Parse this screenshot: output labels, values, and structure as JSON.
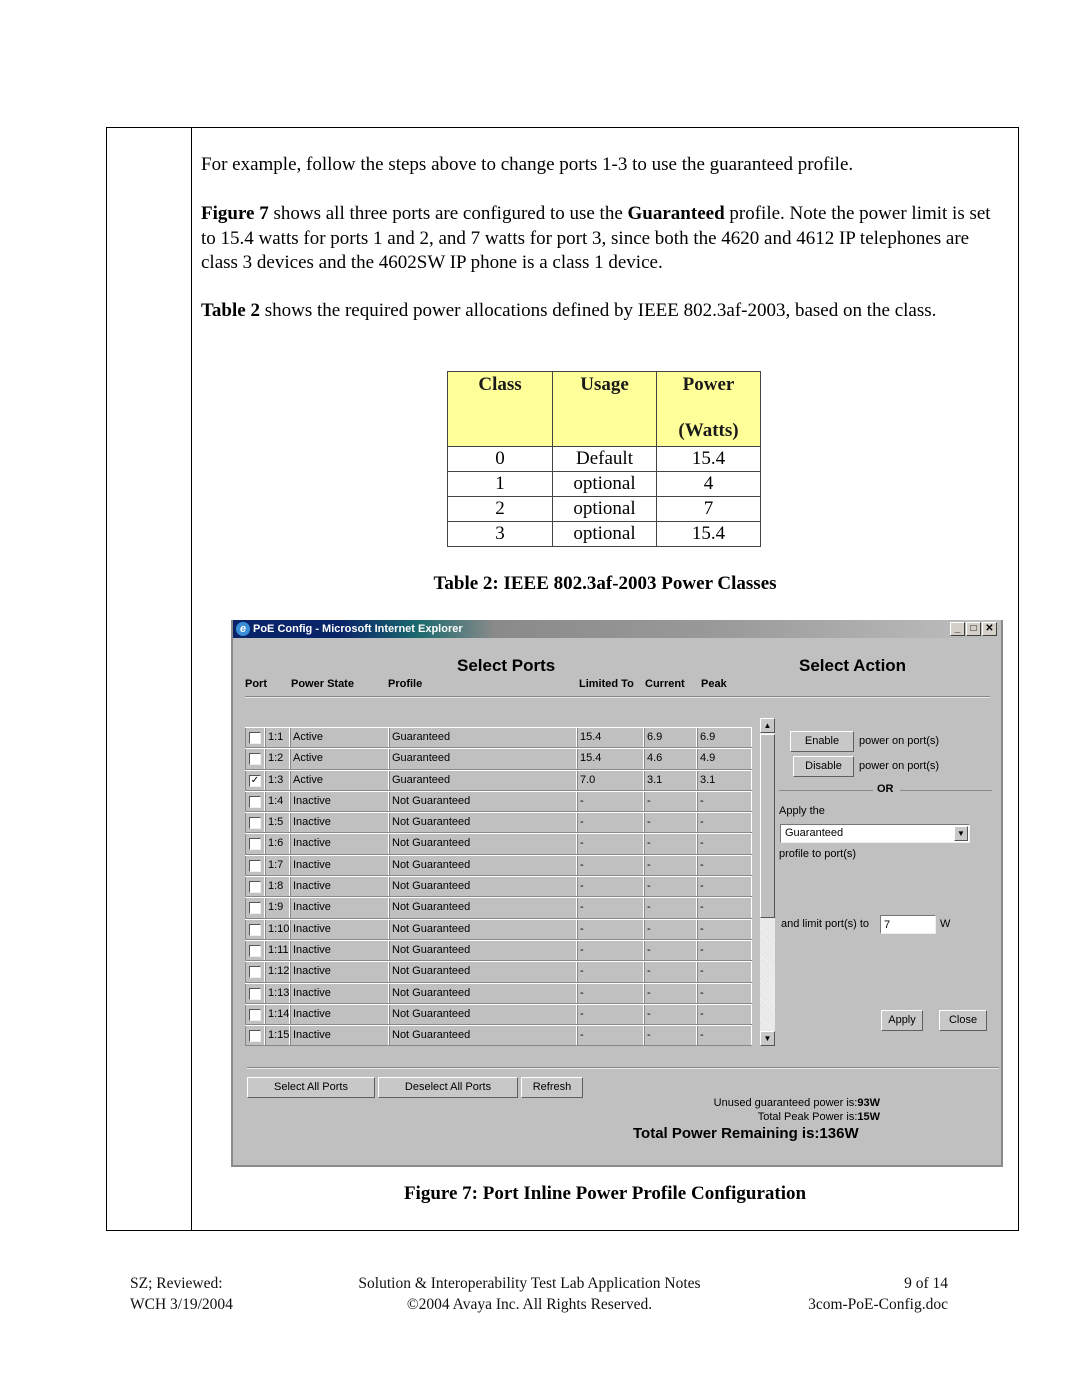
{
  "document": {
    "paragraphs": {
      "p1": "For example, follow the steps above to change ports 1-3 to use the guaranteed profile.",
      "p2_bold1": "Figure 7",
      "p2_text1": " shows all three ports are configured to use the ",
      "p2_bold2": "Guaranteed",
      "p2_text2": " profile. Note the power limit is set to 15.4 watts for ports 1 and 2, and 7 watts for port 3, since both the 4620 and 4612 IP telephones are class 3 devices and the 4602SW IP phone is a class 1 device.",
      "p3_bold": "Table 2",
      "p3_text": " shows the required power allocations defined by IEEE 802.3af-2003, based on the class."
    },
    "power_table": {
      "headers": [
        "Class",
        "Usage",
        "Power",
        "(Watts)"
      ],
      "rows": [
        [
          "0",
          "Default",
          "15.4"
        ],
        [
          "1",
          "optional",
          "4"
        ],
        [
          "2",
          "optional",
          "7"
        ],
        [
          "3",
          "optional",
          "15.4"
        ]
      ],
      "header_color": "#ffff99"
    },
    "table_caption": "Table 2: IEEE 802.3af-2003 Power Classes",
    "figure_caption": "Figure 7: Port Inline Power Profile Configuration",
    "footer": {
      "left_line1": "SZ; Reviewed:",
      "left_line2": "WCH 3/19/2004",
      "center_line1": "Solution & Interoperability Test Lab Application Notes",
      "center_line2": "©2004 Avaya Inc. All Rights Reserved.",
      "right_line1": "9 of 14",
      "right_line2": "3com-PoE-Config.doc"
    }
  },
  "window": {
    "title": "PoE Config - Microsoft Internet Explorer",
    "controls": {
      "minimize": "_",
      "maximize": "□",
      "close": "✕"
    },
    "select_ports_title": "Select Ports",
    "select_action_title": "Select Action",
    "columns": [
      "Port",
      "Power State",
      "Profile",
      "Limited To",
      "Current",
      "Peak"
    ],
    "ports": [
      {
        "checked": false,
        "port": "1:1",
        "state": "Active",
        "profile": "Guaranteed",
        "limit": "15.4",
        "current": "6.9",
        "peak": "6.9"
      },
      {
        "checked": false,
        "port": "1:2",
        "state": "Active",
        "profile": "Guaranteed",
        "limit": "15.4",
        "current": "4.6",
        "peak": "4.9"
      },
      {
        "checked": true,
        "port": "1:3",
        "state": "Active",
        "profile": "Guaranteed",
        "limit": "7.0",
        "current": "3.1",
        "peak": "3.1"
      },
      {
        "checked": false,
        "port": "1:4",
        "state": "Inactive",
        "profile": "Not Guaranteed",
        "limit": "-",
        "current": "-",
        "peak": "-"
      },
      {
        "checked": false,
        "port": "1:5",
        "state": "Inactive",
        "profile": "Not Guaranteed",
        "limit": "-",
        "current": "-",
        "peak": "-"
      },
      {
        "checked": false,
        "port": "1:6",
        "state": "Inactive",
        "profile": "Not Guaranteed",
        "limit": "-",
        "current": "-",
        "peak": "-"
      },
      {
        "checked": false,
        "port": "1:7",
        "state": "Inactive",
        "profile": "Not Guaranteed",
        "limit": "-",
        "current": "-",
        "peak": "-"
      },
      {
        "checked": false,
        "port": "1:8",
        "state": "Inactive",
        "profile": "Not Guaranteed",
        "limit": "-",
        "current": "-",
        "peak": "-"
      },
      {
        "checked": false,
        "port": "1:9",
        "state": "Inactive",
        "profile": "Not Guaranteed",
        "limit": "-",
        "current": "-",
        "peak": "-"
      },
      {
        "checked": false,
        "port": "1:10",
        "state": "Inactive",
        "profile": "Not Guaranteed",
        "limit": "-",
        "current": "-",
        "peak": "-"
      },
      {
        "checked": false,
        "port": "1:11",
        "state": "Inactive",
        "profile": "Not Guaranteed",
        "limit": "-",
        "current": "-",
        "peak": "-"
      },
      {
        "checked": false,
        "port": "1:12",
        "state": "Inactive",
        "profile": "Not Guaranteed",
        "limit": "-",
        "current": "-",
        "peak": "-"
      },
      {
        "checked": false,
        "port": "1:13",
        "state": "Inactive",
        "profile": "Not Guaranteed",
        "limit": "-",
        "current": "-",
        "peak": "-"
      },
      {
        "checked": false,
        "port": "1:14",
        "state": "Inactive",
        "profile": "Not Guaranteed",
        "limit": "-",
        "current": "-",
        "peak": "-"
      },
      {
        "checked": false,
        "port": "1:15",
        "state": "Inactive",
        "profile": "Not Guaranteed",
        "limit": "-",
        "current": "-",
        "peak": "-"
      }
    ],
    "actions": {
      "enable_label": "Enable",
      "disable_label": "Disable",
      "power_on_ports": "power on port(s)",
      "or_label": "OR",
      "apply_the": "Apply the",
      "profile_selected": "Guaranteed",
      "profile_to_ports": "profile to port(s)",
      "limit_label": "and limit port(s) to",
      "limit_value": "7",
      "limit_unit": "W",
      "apply_label": "Apply",
      "close_label": "Close"
    },
    "bottom_buttons": {
      "select_all": "Select All Ports",
      "deselect_all": "Deselect All Ports",
      "refresh": "Refresh"
    },
    "status": {
      "unused_label": "Unused guaranteed power is:",
      "unused_value": "93W",
      "peak_label": "Total Peak Power is:",
      "peak_value": "15W",
      "remaining": "Total Power Remaining is:136W"
    }
  }
}
